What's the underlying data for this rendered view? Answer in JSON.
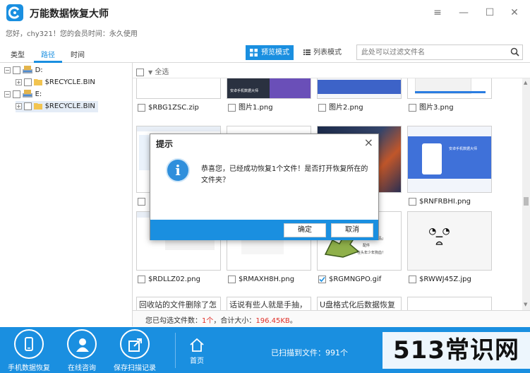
{
  "app": {
    "title": "万能数据恢复大师"
  },
  "welcome": {
    "text": "您好，chy321！您的会员时间：永久使用"
  },
  "tabs": [
    {
      "label": "类型"
    },
    {
      "label": "路径"
    },
    {
      "label": "时间"
    }
  ],
  "toolbar": {
    "preview_mode": "预览模式",
    "list_mode": "列表模式",
    "search_placeholder": "此处可以过滤文件名"
  },
  "tree": [
    {
      "label": "D:",
      "kind": "drive"
    },
    {
      "label": "$RECYCLE.BIN",
      "kind": "folder"
    },
    {
      "label": "E:",
      "kind": "drive"
    },
    {
      "label": "$RECYCLE.BIN",
      "kind": "folder"
    }
  ],
  "content": {
    "select_all": "全选"
  },
  "files": [
    {
      "name": "$RBG1ZSC.zip",
      "checked": false
    },
    {
      "name": "图片1.png",
      "checked": false
    },
    {
      "name": "图片2.png",
      "checked": false
    },
    {
      "name": "图片3.png",
      "checked": false
    },
    {
      "name": "",
      "checked": false
    },
    {
      "name": "",
      "checked": false
    },
    {
      "name": "",
      "checked": false
    },
    {
      "name": "$RNFRBHI.png",
      "checked": false
    },
    {
      "name": "$RDLLZ02.png",
      "checked": false
    },
    {
      "name": "$RMAXH8H.png",
      "checked": false
    },
    {
      "name": "$RGMNGPO.gif",
      "checked": true
    },
    {
      "name": "$RWWJ45Z.jpg",
      "checked": false
    }
  ],
  "text_previews": [
    "回收站的文件删除了怎",
    "话说有些人就是手抽，",
    "U盘格式化后数据恢复用"
  ],
  "image_texts": {
    "banner": "安卓手机数据大师",
    "gif_caption1": "一般的「战利品」",
    "gif_caption2": "配件",
    "gif_caption3": "在头年少年狗血！"
  },
  "status": {
    "prefix": "您已勾选文件数：",
    "count": "1个",
    "mid": "，合计大小：",
    "size": "196.45KB",
    "suffix": "。"
  },
  "bottom": {
    "phone_recovery": "手机数据恢复",
    "online_consult": "在线咨询",
    "save_record": "保存扫描记录",
    "home": "首页",
    "scanned": "已扫描到文件：991个"
  },
  "dialog": {
    "title": "提示",
    "message": "恭喜您，已经成功恢复1个文件！是否打开恢复所在的文件夹？",
    "ok": "确定",
    "cancel": "取消"
  },
  "watermark": {
    "text": "513常识网"
  },
  "colors": {
    "accent": "#1a8fe0",
    "highlight": "#e0312a"
  }
}
